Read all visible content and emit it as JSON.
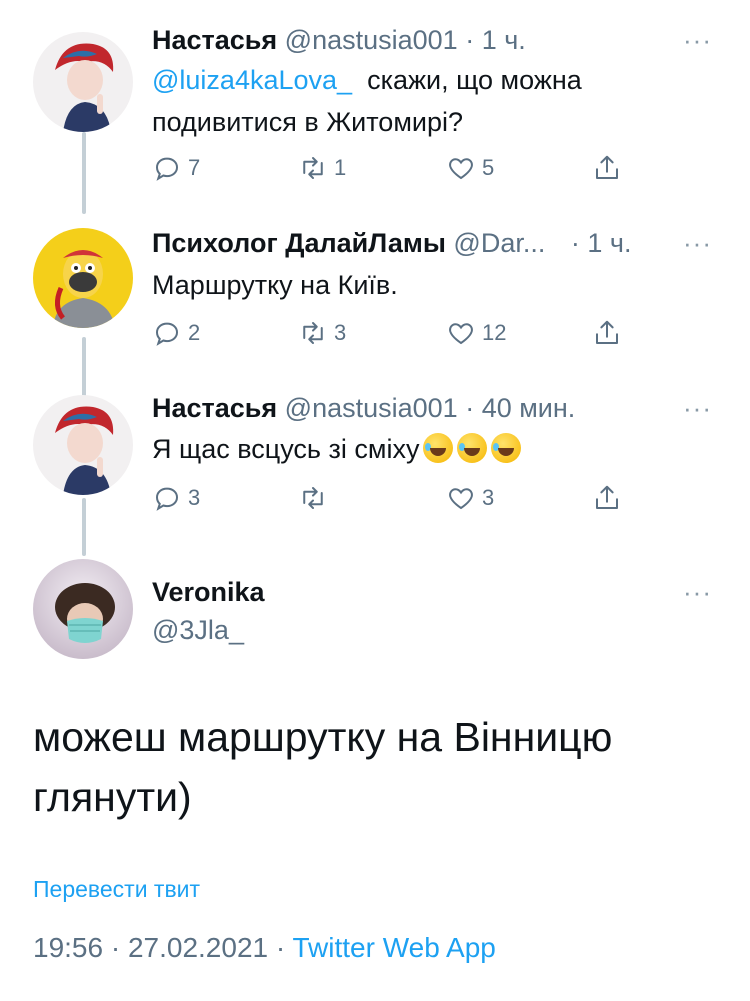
{
  "tweets": [
    {
      "name": "Настасья",
      "handle": "@nastusia001",
      "time": "· 1 ч.",
      "mention": "@luiza4kaLova_",
      "text": "скажи, що можна подивитися в Житомирі?",
      "replies": "7",
      "retweets": "1",
      "likes": "5",
      "more": "···"
    },
    {
      "name": "Психолог ДалайЛамы",
      "handle": "@Dar...",
      "time": "· 1 ч.",
      "text": "Маршрутку на Київ.",
      "replies": "2",
      "retweets": "3",
      "likes": "12",
      "more": "···"
    },
    {
      "name": "Настасья",
      "handle": "@nastusia001",
      "time": "· 40 мин.",
      "text": "Я щас всцусь зі сміху",
      "emoji_name": "rolling-on-floor-laughing-emoji",
      "replies": "3",
      "retweets": "",
      "likes": "3",
      "more": "···"
    }
  ],
  "main_tweet": {
    "name": "Veronika",
    "handle": "@3Jla_",
    "more": "···",
    "text": "можеш маршрутку на Вінницю глянути)",
    "translate_label": "Перевести твит",
    "timestamp": "19:56 · 27.02.2021 ·",
    "source": "Twitter Web App"
  },
  "colors": {
    "accent": "#1da1f2",
    "secondary_text": "#5b7083",
    "thread_line": "#c4cfd6"
  },
  "icons": [
    "reply-icon",
    "retweet-icon",
    "like-icon",
    "share-icon",
    "more-icon"
  ]
}
